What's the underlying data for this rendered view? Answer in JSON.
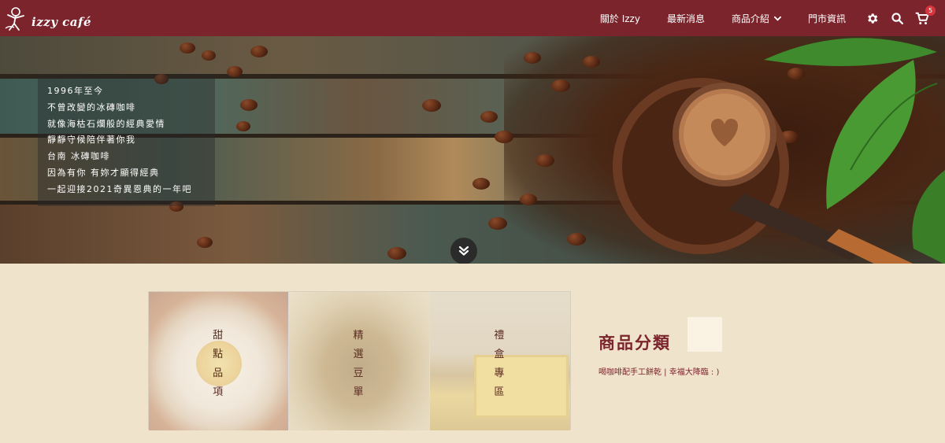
{
  "brand": {
    "logo_text": "izzy café"
  },
  "nav": {
    "items": [
      {
        "label": "關於 Izzy"
      },
      {
        "label": "最新消息"
      },
      {
        "label": "商品介紹"
      },
      {
        "label": "門市資訊"
      }
    ],
    "cart_count": "5",
    "icons": [
      "gear-icon",
      "search-icon",
      "cart-icon",
      "chevron-down-icon"
    ]
  },
  "hero": {
    "lines": [
      "1996年至今",
      "不曾改變的冰磚咖啡",
      "就像海枯石爛般的經典愛情",
      "靜靜守候陪伴著你我",
      "台南 冰磚咖啡",
      "因為有你 有妳才顯得經典",
      "一起迎接2021奇異恩典的一年吧"
    ],
    "scroll_icon": "double-chevron-down-icon"
  },
  "categories": {
    "items": [
      {
        "label": [
          "甜",
          "點",
          "品",
          "項"
        ]
      },
      {
        "label": [
          "精",
          "選",
          "豆",
          "單"
        ]
      },
      {
        "label": [
          "禮",
          "盒",
          "專",
          "區"
        ]
      }
    ],
    "title": "商品分類",
    "subtitle": "喝咖啡配手工餅乾 | 幸福大降臨 : )"
  },
  "colors": {
    "brand": "#7b242c",
    "background": "#efe3cb"
  }
}
